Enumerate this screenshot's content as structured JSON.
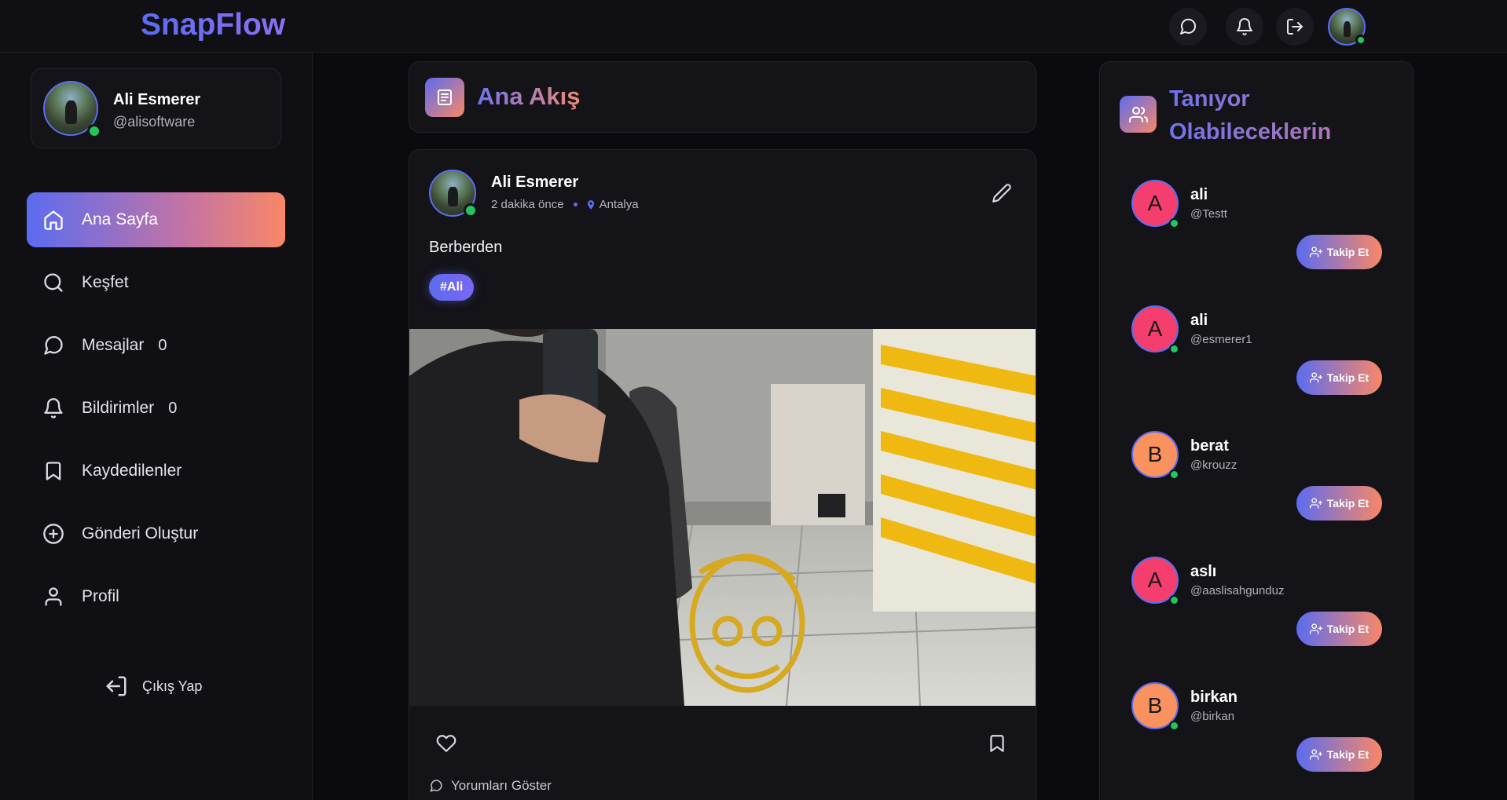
{
  "app": {
    "name": "SnapFlow"
  },
  "topbar": {
    "icons": [
      "message-icon",
      "bell-icon",
      "logout-icon",
      "user-avatar"
    ]
  },
  "user": {
    "name": "Ali Esmerer",
    "handle": "@alisoftware"
  },
  "nav": {
    "items": [
      {
        "label": "Ana Sayfa",
        "icon": "home-icon",
        "active": true
      },
      {
        "label": "Keşfet",
        "icon": "search-icon"
      },
      {
        "label": "Mesajlar",
        "icon": "message-icon",
        "count": "0"
      },
      {
        "label": "Bildirimler",
        "icon": "bell-icon",
        "count": "0"
      },
      {
        "label": "Kaydedilenler",
        "icon": "bookmark-icon"
      },
      {
        "label": "Gönderi Oluştur",
        "icon": "plus-circle-icon"
      },
      {
        "label": "Profil",
        "icon": "user-icon"
      }
    ],
    "logout_label": "Çıkış Yap"
  },
  "feed": {
    "title": "Ana Akış",
    "post": {
      "author": "Ali Esmerer",
      "time": "2 dakika önce",
      "location": "Antalya",
      "text": "Berberden",
      "tag": "#Ali",
      "comments_label": "Yorumları Göster"
    }
  },
  "suggestions": {
    "title": "Tanıyor Olabileceklerin",
    "follow_label": "Takip Et",
    "items": [
      {
        "initial": "A",
        "name": "ali",
        "handle": "@Testt",
        "color": "#f43f6e"
      },
      {
        "initial": "A",
        "name": "ali",
        "handle": "@esmerer1",
        "color": "#f43f6e"
      },
      {
        "initial": "B",
        "name": "berat",
        "handle": "@krouzz",
        "color": "#f9925f"
      },
      {
        "initial": "A",
        "name": "aslı",
        "handle": "@aaslisahgunduz",
        "color": "#f43f6e"
      },
      {
        "initial": "B",
        "name": "birkan",
        "handle": "@birkan",
        "color": "#f9925f"
      }
    ]
  },
  "colors": {
    "accent": "#5b6cf0",
    "accent_end": "#f98767",
    "online": "#22c55e",
    "background": "#0b0b0f"
  }
}
